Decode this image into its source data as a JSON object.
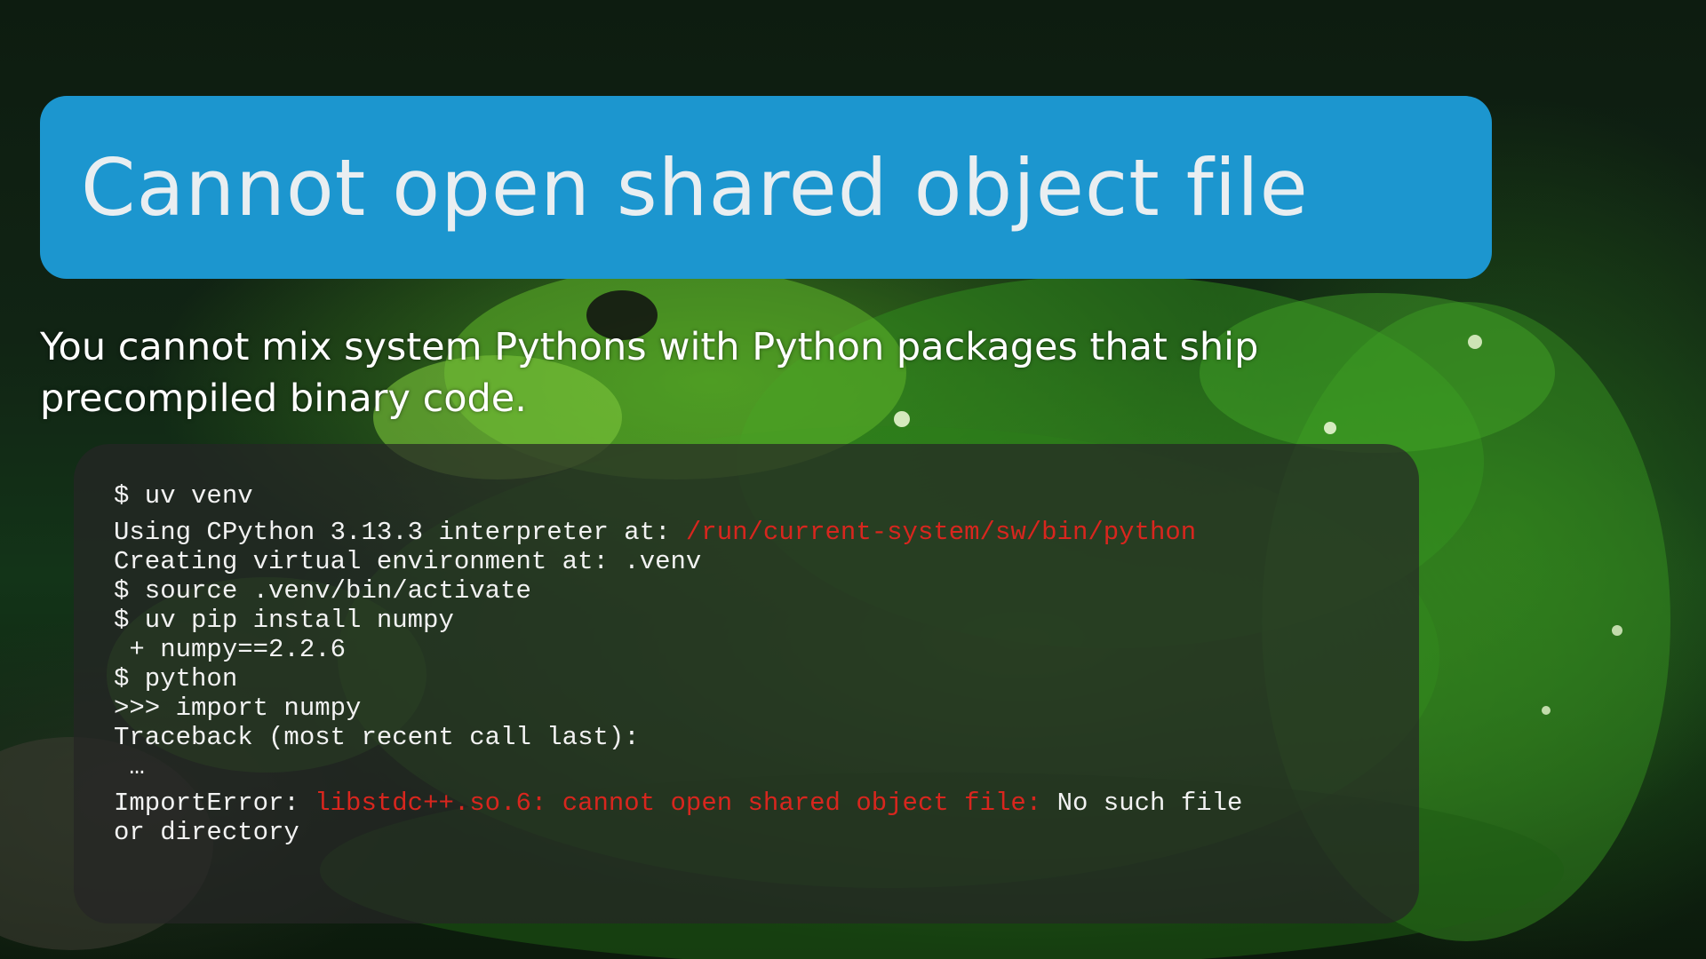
{
  "title": "Cannot open shared object file",
  "subtitle": "You cannot mix system Pythons with Python packages that ship precompiled binary code.",
  "terminal": {
    "lines": {
      "l1": "$ uv venv",
      "l2_prefix": "Using CPython 3.13.3 interpreter at: ",
      "l2_path": "/run/current-system/sw/bin/python",
      "l3": "Creating virtual environment at: .venv",
      "l4": "$ source .venv/bin/activate",
      "l5": "$ uv pip install numpy",
      "l6": " + numpy==2.2.6",
      "l7": "$ python",
      "l8": ">>> import numpy",
      "l9": "Traceback (most recent call last):",
      "l10": " …",
      "l11_prefix": "ImportError: ",
      "l11_error": "libstdc++.so.6: cannot open shared object file:",
      "l11_suffix": " No such file",
      "l12": "or directory"
    }
  },
  "colors": {
    "title_bg": "#1c96cf",
    "title_text": "#e9eef1",
    "terminal_error": "#d8261e"
  }
}
